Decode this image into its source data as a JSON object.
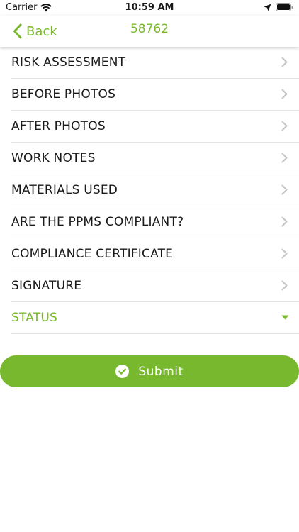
{
  "status_bar": {
    "carrier": "Carrier",
    "time": "10:59 AM",
    "icons": [
      "wifi-icon",
      "location-arrow-icon",
      "battery-icon"
    ]
  },
  "nav": {
    "back_label": "Back",
    "title": "58762",
    "icons": [
      "chevron-left-icon"
    ]
  },
  "menu": {
    "items": [
      {
        "label": "RISK ASSESSMENT",
        "icon": "chevron-right-icon"
      },
      {
        "label": "BEFORE PHOTOS",
        "icon": "chevron-right-icon"
      },
      {
        "label": "AFTER PHOTOS",
        "icon": "chevron-right-icon"
      },
      {
        "label": "WORK NOTES",
        "icon": "chevron-right-icon"
      },
      {
        "label": "MATERIALS USED",
        "icon": "chevron-right-icon"
      },
      {
        "label": "ARE THE PPMS COMPLIANT?",
        "icon": "chevron-right-icon"
      },
      {
        "label": "COMPLIANCE CERTIFICATE",
        "icon": "chevron-right-icon"
      },
      {
        "label": "SIGNATURE",
        "icon": "chevron-right-icon"
      },
      {
        "label": "STATUS",
        "icon": "caret-down-icon"
      }
    ]
  },
  "submit": {
    "label": "Submit",
    "icon": "check-circle-icon"
  },
  "colors": {
    "accent": "#7ab82f",
    "button": "#77b82f",
    "divider": "#e4e4e4",
    "chevron": "#c4c4c4"
  }
}
